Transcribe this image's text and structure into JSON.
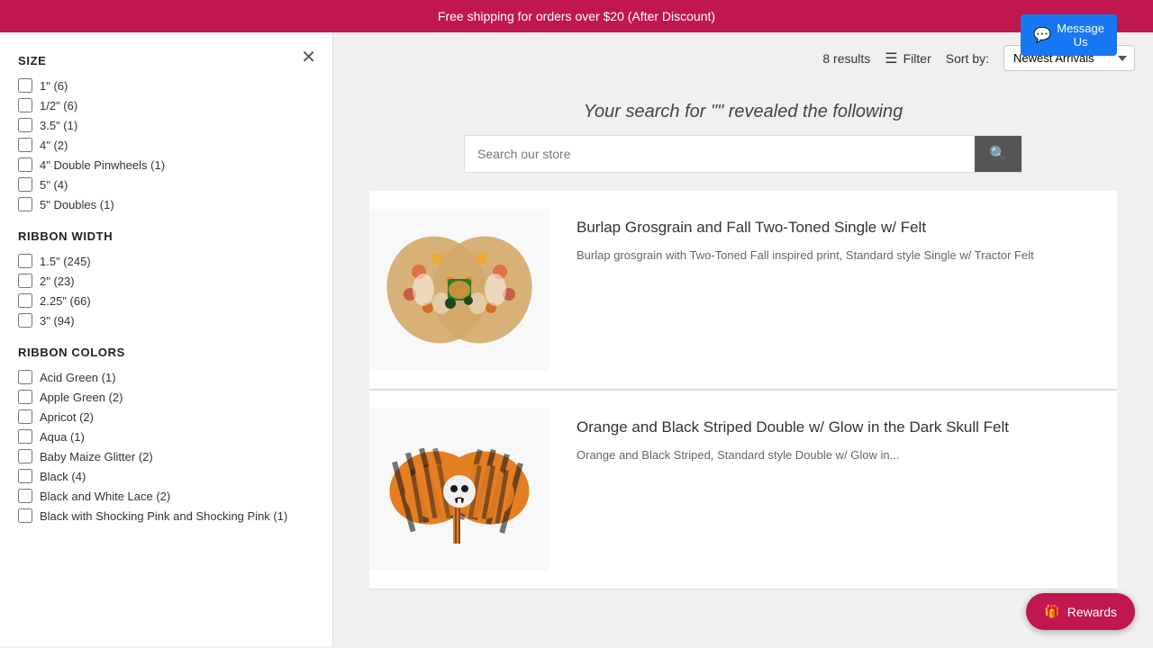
{
  "banner": {
    "text": "Free shipping for orders over $20 (After Discount)"
  },
  "header": {
    "message_us_label": "Message Us"
  },
  "results": {
    "count_text": "8 results"
  },
  "filter_sort": {
    "filter_label": "Filter",
    "sort_label": "Sort by:",
    "sort_option": "Newest Arrivals"
  },
  "search": {
    "title": "Your search for \"\" revealed the following",
    "placeholder": "Search our store"
  },
  "sidebar": {
    "size_title": "SIZE",
    "size_items": [
      {
        "label": "1\" (6)"
      },
      {
        "label": "1/2\" (6)"
      },
      {
        "label": "3.5\" (1)"
      },
      {
        "label": "4\" (2)"
      },
      {
        "label": "4\" Double Pinwheels (1)"
      },
      {
        "label": "5\" (4)"
      },
      {
        "label": "5\" Doubles (1)"
      }
    ],
    "ribbon_width_title": "RIBBON WIDTH",
    "ribbon_width_items": [
      {
        "label": "1.5\" (245)"
      },
      {
        "label": "2\" (23)"
      },
      {
        "label": "2.25\" (66)"
      },
      {
        "label": "3\" (94)"
      }
    ],
    "ribbon_colors_title": "RIBBON COLORS",
    "ribbon_color_items": [
      {
        "label": "Acid Green (1)"
      },
      {
        "label": "Apple Green (2)"
      },
      {
        "label": "Apricot (2)"
      },
      {
        "label": "Aqua (1)"
      },
      {
        "label": "Baby Maize Glitter (2)"
      },
      {
        "label": "Black (4)"
      },
      {
        "label": "Black and White Lace (2)"
      },
      {
        "label": "Black with Shocking Pink and Shocking Pink (1)"
      }
    ]
  },
  "products": [
    {
      "title": "Burlap Grosgrain and Fall Two-Toned Single w/ Felt",
      "description": "Burlap grosgrain with Two-Toned Fall inspired print, Standard style Single w/ Tractor Felt",
      "type": "fall-bow"
    },
    {
      "title": "Orange and Black Striped Double w/ Glow in the Dark Skull Felt",
      "description": "Orange and Black Striped, Standard style Double w/ Glow in...",
      "type": "halloween-bow"
    }
  ],
  "rewards": {
    "label": "Rewards"
  }
}
